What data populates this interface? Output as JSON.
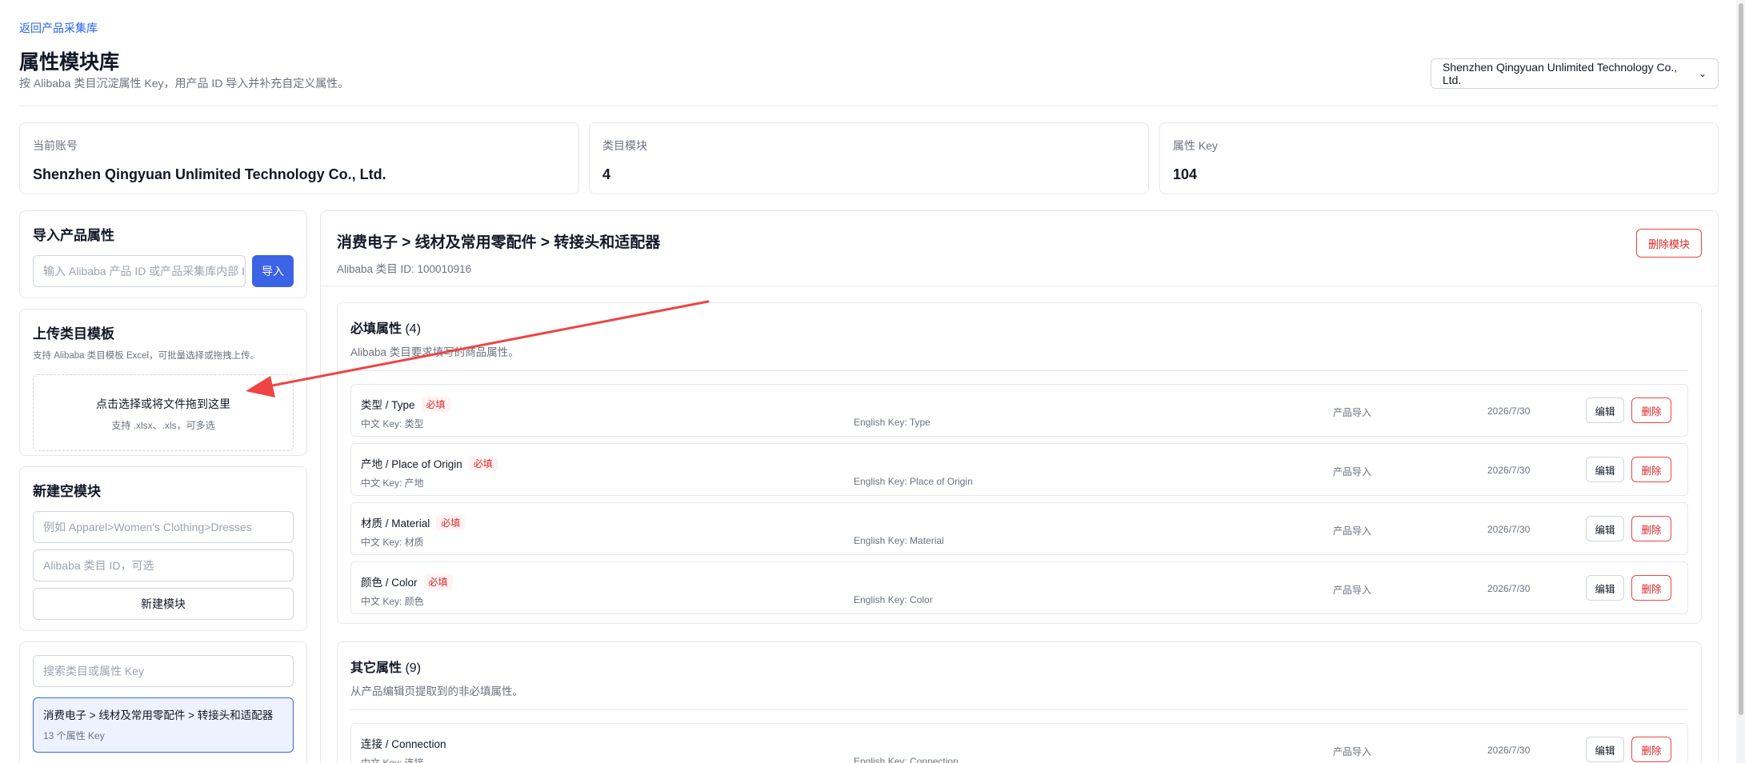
{
  "header": {
    "back_link": "返回产品采集库",
    "title": "属性模块库",
    "subtitle": "按 Alibaba 类目沉淀属性 Key，用产品 ID 导入并补充自定义属性。",
    "account_select": "Shenzhen Qingyuan Unlimited Technology Co., Ltd."
  },
  "stats": {
    "account": {
      "label": "当前账号",
      "value": "Shenzhen Qingyuan Unlimited Technology Co., Ltd."
    },
    "modules": {
      "label": "类目模块",
      "value": "4"
    },
    "keys": {
      "label": "属性 Key",
      "value": "104"
    }
  },
  "import_panel": {
    "title": "导入产品属性",
    "placeholder": "输入 Alibaba 产品 ID 或产品采集库内部 ID",
    "button": "导入"
  },
  "upload_panel": {
    "title": "上传类目模板",
    "hint": "支持 Alibaba 类目模板 Excel，可批量选择或拖拽上传。",
    "drop_main": "点击选择或将文件拖到这里",
    "drop_sub": "支持 .xlsx、.xls，可多选"
  },
  "new_module_panel": {
    "title": "新建空模块",
    "path_placeholder": "例如 Apparel>Women's Clothing>Dresses",
    "id_placeholder": "Alibaba 类目 ID，可选",
    "button": "新建模块"
  },
  "search_panel": {
    "placeholder": "搜索类目或属性 Key",
    "modules": [
      {
        "title": "消费电子 > 线材及常用零配件 > 转接头和适配器",
        "count": "13 个属性 Key"
      }
    ]
  },
  "module": {
    "title": "消费电子 > 线材及常用零配件 > 转接头和适配器",
    "category_id": "Alibaba 类目 ID: 100010916",
    "delete_button": "删除模块"
  },
  "required_section": {
    "title": "必填属性",
    "count": "(4)",
    "desc": "Alibaba 类目要求填写的商品属性。",
    "rows": [
      {
        "name": "类型 / Type",
        "badge": "必填",
        "zh_key": "中文 Key: 类型",
        "en_key": "English Key: Type",
        "source": "产品导入",
        "date": "2026/7/30",
        "edit": "编辑",
        "delete": "删除"
      },
      {
        "name": "产地 / Place of Origin",
        "badge": "必填",
        "zh_key": "中文 Key: 产地",
        "en_key": "English Key: Place of Origin",
        "source": "产品导入",
        "date": "2026/7/30",
        "edit": "编辑",
        "delete": "删除"
      },
      {
        "name": "材质 / Material",
        "badge": "必填",
        "zh_key": "中文 Key: 材质",
        "en_key": "English Key: Material",
        "source": "产品导入",
        "date": "2026/7/30",
        "edit": "编辑",
        "delete": "删除"
      },
      {
        "name": "颜色 / Color",
        "badge": "必填",
        "zh_key": "中文 Key: 颜色",
        "en_key": "English Key: Color",
        "source": "产品导入",
        "date": "2026/7/30",
        "edit": "编辑",
        "delete": "删除"
      }
    ]
  },
  "other_section": {
    "title": "其它属性",
    "count": "(9)",
    "desc": "从产品编辑页提取到的非必填属性。",
    "rows": [
      {
        "name": "连接 / Connection",
        "zh_key": "中文 Key: 连接",
        "en_key": "English Key: Connection",
        "source": "产品导入",
        "date": "2026/7/30",
        "edit": "编辑",
        "delete": "删除"
      }
    ]
  },
  "icons": {
    "select_chevron": "chevron-down-icon",
    "annotation": "red-arrow-annotation"
  },
  "colors": {
    "accent": "#3b63e6",
    "danger": "#dc2626",
    "arrow": "#ef4444"
  }
}
